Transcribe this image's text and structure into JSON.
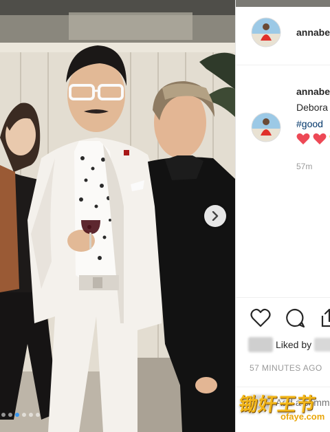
{
  "post": {
    "username": "annabe",
    "caption_user": "annabe",
    "caption_text": "Debora",
    "caption_tag": "#good",
    "caption_time": "57m",
    "liked_by_text": "Liked by",
    "timestamp": "57 MINUTES AGO",
    "comment_placeholder": "Add a comment"
  },
  "photo": {
    "image_count": 6,
    "active_index": 2
  },
  "watermark": {
    "cn_text": "锄奸王节",
    "url_text": "ofaye.com"
  },
  "icons": {
    "carousel_next": "chevron-right-icon",
    "like": "heart-icon",
    "comment": "comment-icon",
    "share": "share-icon",
    "caption_hearts": "red-heart-icon"
  },
  "colors": {
    "link": "#003569",
    "muted": "#999999",
    "heart": "#ed4956",
    "watermark": "#f2b61a"
  }
}
